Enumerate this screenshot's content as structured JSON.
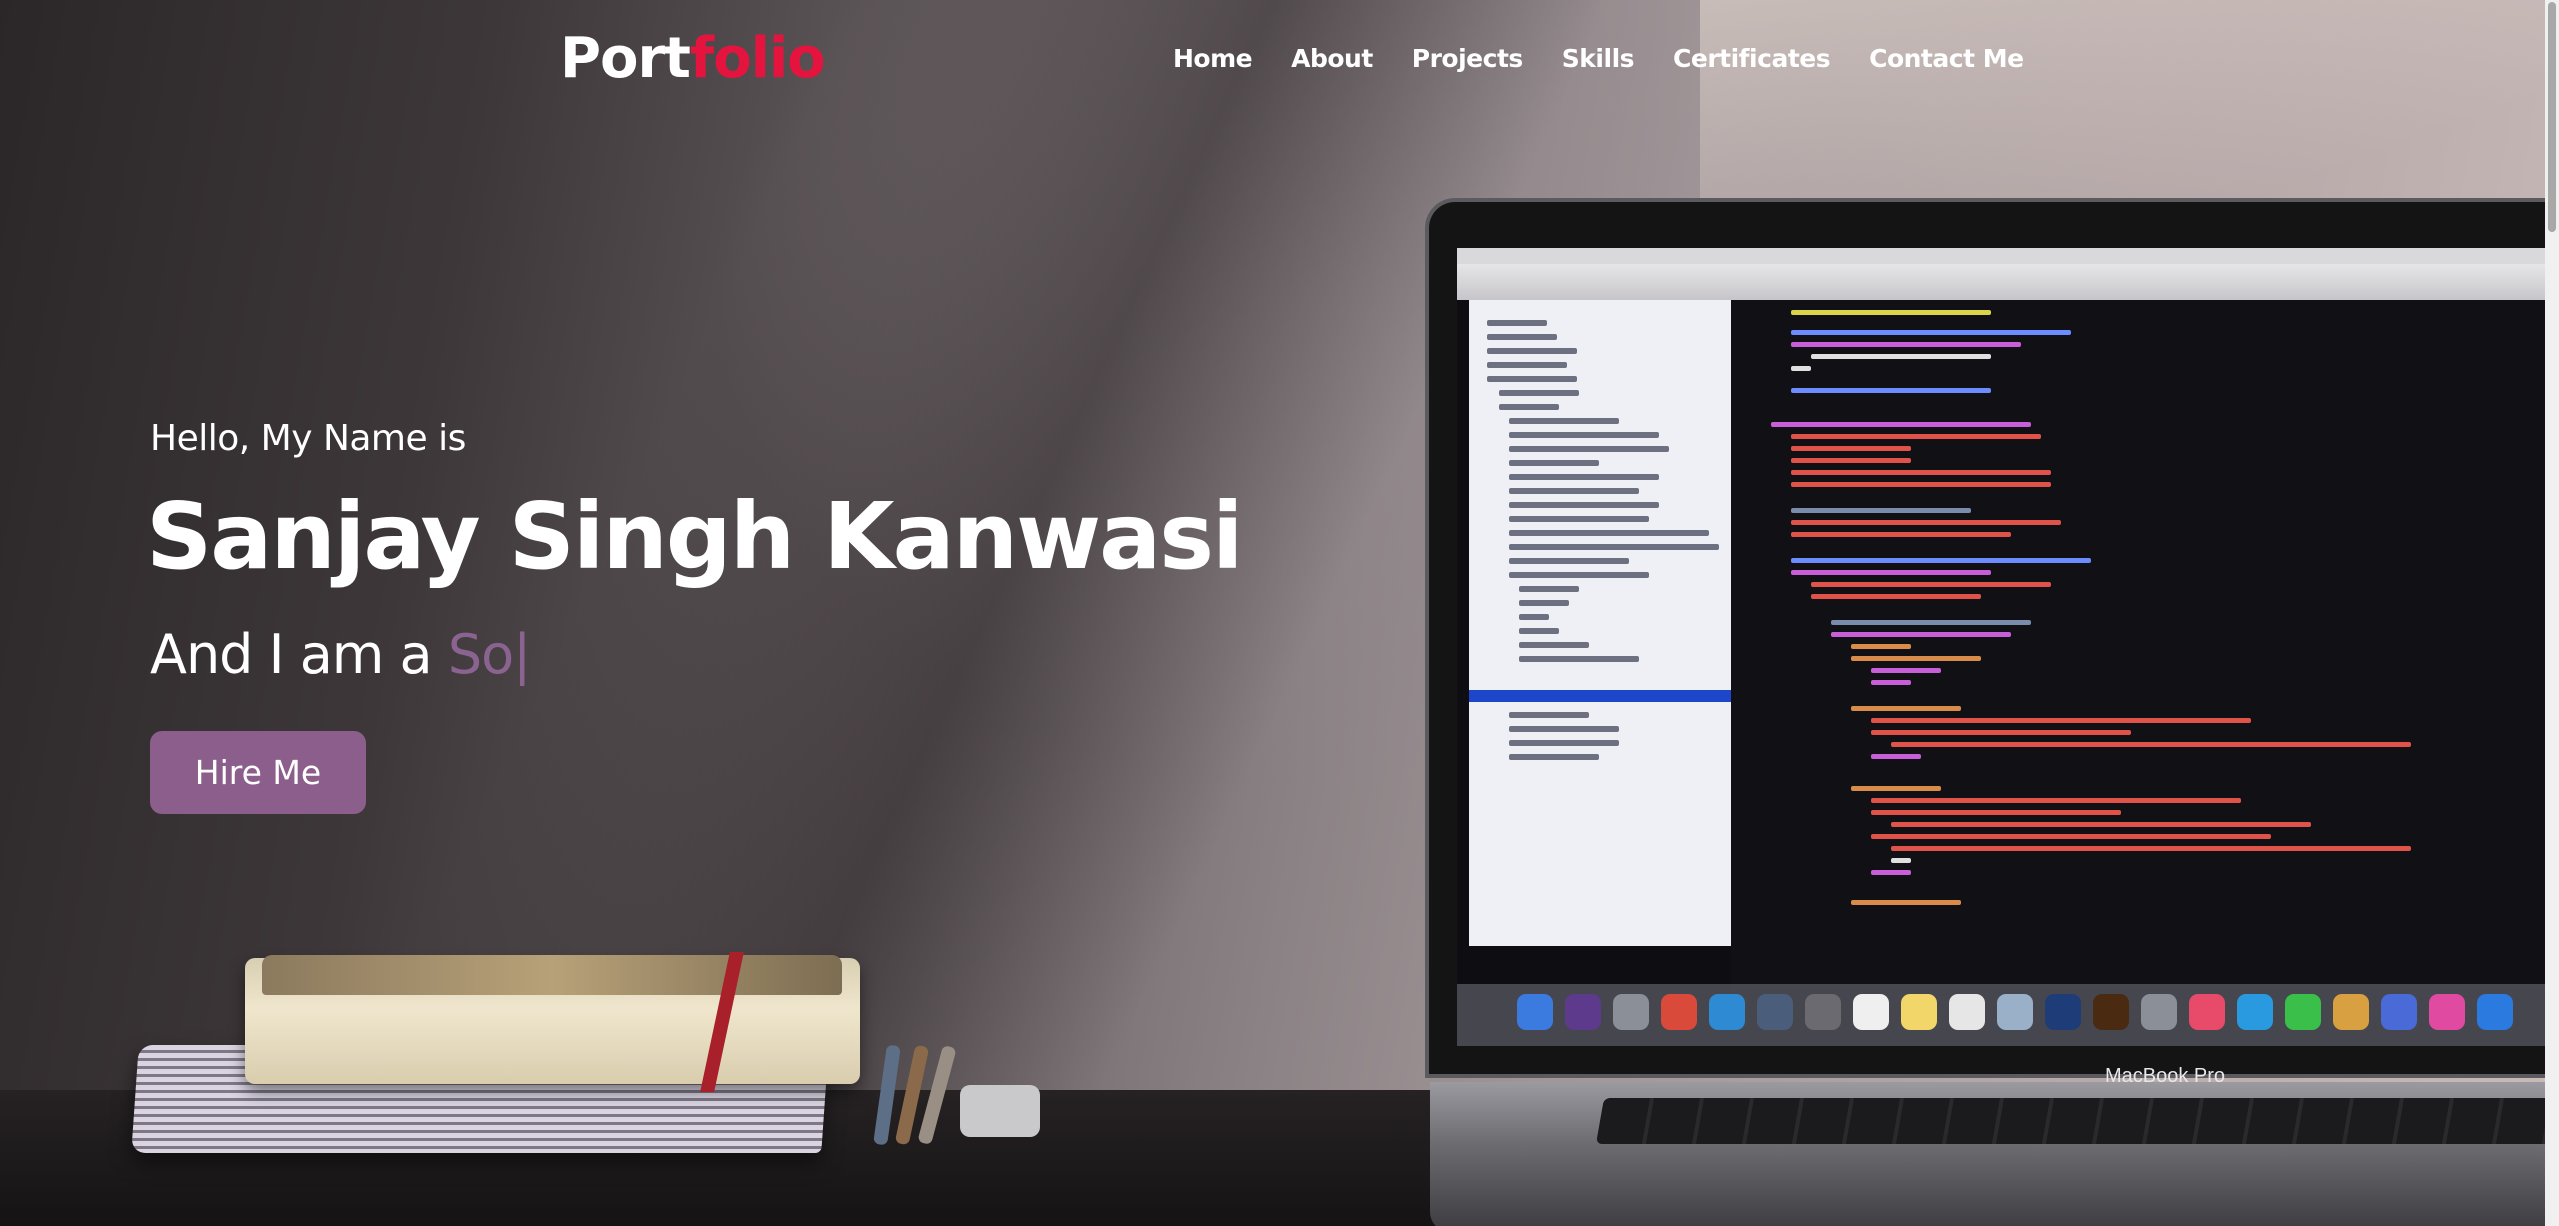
{
  "header": {
    "logo_main": "Port",
    "logo_accent": "folio",
    "nav": [
      {
        "label": "Home"
      },
      {
        "label": "About"
      },
      {
        "label": "Projects"
      },
      {
        "label": "Skills"
      },
      {
        "label": "Certificates"
      },
      {
        "label": "Contact Me"
      }
    ]
  },
  "hero": {
    "greeting": "Hello, My Name is",
    "name": "Sanjay Singh Kanwasi",
    "role_prefix": "And I am a",
    "role_typed": "So",
    "cursor": "|",
    "cta_label": "Hire Me"
  },
  "background": {
    "laptop_label": "MacBook Pro"
  },
  "colors": {
    "accent_red": "#e4143e",
    "accent_purple": "#8b5e8c",
    "text": "#ffffff"
  }
}
